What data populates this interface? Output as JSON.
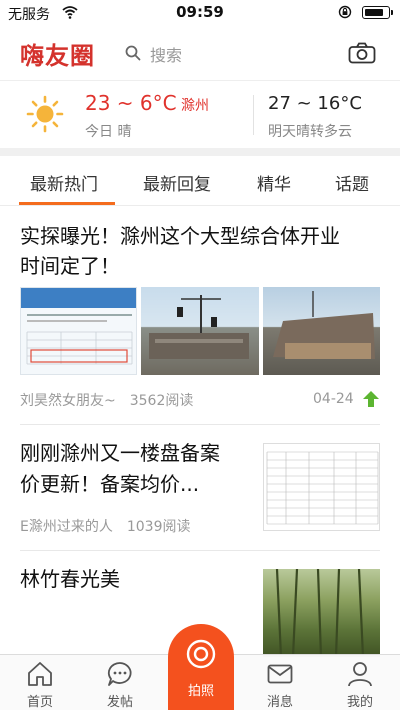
{
  "status_bar": {
    "carrier": "无服务",
    "time": "09:59",
    "battery_level": 0.85
  },
  "header": {
    "app_name": "嗨友圈",
    "search_placeholder": "搜索"
  },
  "weather": {
    "today_temp": "23 ~ 6°C",
    "city": "滁州",
    "today_desc": "今日 晴",
    "tomorrow_temp": "27 ~ 16°C",
    "tomorrow_desc": "明天晴转多云"
  },
  "tabs": [
    {
      "label": "最新热门",
      "active": true
    },
    {
      "label": "最新回复",
      "active": false
    },
    {
      "label": "精华",
      "active": false
    },
    {
      "label": "话题",
      "active": false
    }
  ],
  "posts": [
    {
      "title_line1": "实探曝光！滁州这个大型综合体开业",
      "title_line2": "时间定了！",
      "author": "刘昊然女朋友~",
      "views": "3562阅读",
      "date": "04-24"
    },
    {
      "title_line1": "刚刚滁州又一楼盘备案",
      "title_line2": "价更新！备案均价...",
      "author": "E滁州过来的人",
      "views": "1039阅读"
    },
    {
      "title_line1": "林竹春光美"
    }
  ],
  "bottom_tabs": [
    {
      "label": "首页"
    },
    {
      "label": "发帖"
    },
    {
      "label": "拍照"
    },
    {
      "label": "消息"
    },
    {
      "label": "我的"
    }
  ],
  "colors": {
    "brand_red": "#d4322c",
    "accent_orange": "#f46c1e",
    "photo_button": "#f4511e",
    "sun": "#f5b43a"
  }
}
